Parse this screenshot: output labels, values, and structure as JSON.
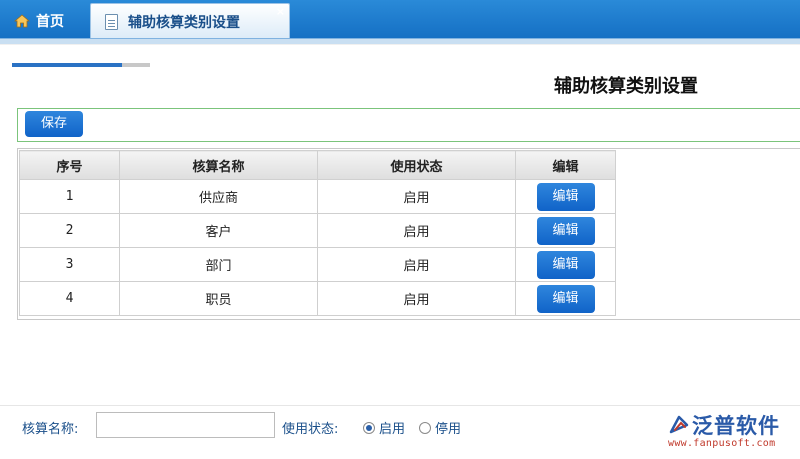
{
  "tabs": {
    "home_label": "首页",
    "active_label": "辅助核算类别设置",
    "close_glyph": "×"
  },
  "page": {
    "title": "辅助核算类别设置",
    "progress_fraction": 0.8
  },
  "toolbar": {
    "save_label": "保存"
  },
  "table": {
    "columns": [
      "序号",
      "核算名称",
      "使用状态",
      "编辑"
    ],
    "rows": [
      {
        "index": "1",
        "name": "供应商",
        "status": "启用",
        "action": "编辑"
      },
      {
        "index": "2",
        "name": "客户",
        "status": "启用",
        "action": "编辑"
      },
      {
        "index": "3",
        "name": "部门",
        "status": "启用",
        "action": "编辑"
      },
      {
        "index": "4",
        "name": "职员",
        "status": "启用",
        "action": "编辑"
      }
    ]
  },
  "filter": {
    "name_label": "核算名称:",
    "name_value": "",
    "status_label": "使用状态:",
    "options": [
      "启用",
      "停用"
    ],
    "selected": "启用"
  },
  "brand": {
    "name": "泛普软件",
    "url": "www.fanpusoft.com",
    "color": "#2a5aa8",
    "url_color": "#c0392b"
  },
  "icons": {
    "home": "home-icon",
    "page": "page-icon",
    "close": "close-icon",
    "logo": "logo-icon"
  },
  "colors": {
    "tab_bar": "#1a78cc",
    "button": "#1a6fd0",
    "toolbar_border": "#7bc47b"
  }
}
